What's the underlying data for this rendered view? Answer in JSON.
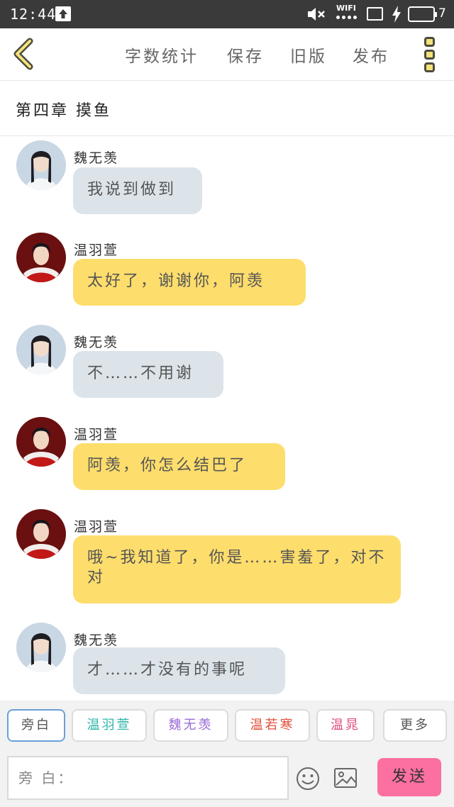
{
  "status_bar": {
    "time": "12:44",
    "network_label": "WIFI",
    "battery_level": "7",
    "battery_fill_fraction": 0.85
  },
  "toolbar": {
    "back_icon": "chevron-left-icon",
    "actions": [
      "字数统计",
      "保存",
      "旧版",
      "发布"
    ],
    "more_icon": "vertical-dots-icon"
  },
  "chapter": {
    "title": "第四章 摸鱼"
  },
  "messages": [
    {
      "sender": "魏无羡",
      "text": "我说到做到",
      "style": "grey"
    },
    {
      "sender": "温羽萱",
      "text": "太好了，谢谢你，阿羡",
      "style": "yellow"
    },
    {
      "sender": "魏无羡",
      "text": "不……不用谢",
      "style": "grey"
    },
    {
      "sender": "温羽萱",
      "text": "阿羡，你怎么结巴了",
      "style": "yellow"
    },
    {
      "sender": "温羽萱",
      "text": "哦~我知道了，你是……害羞了，对不对",
      "style": "yellow"
    },
    {
      "sender": "魏无羡",
      "text": "才……才没有的事呢",
      "style": "grey"
    }
  ],
  "roles": [
    {
      "label": "旁白",
      "color": "#555555"
    },
    {
      "label": "温羽萱",
      "color": "#2ab5a8"
    },
    {
      "label": "魏无羡",
      "color": "#9a6bd6"
    },
    {
      "label": "温若寒",
      "color": "#e2503a"
    },
    {
      "label": "温晁",
      "color": "#e0507f"
    },
    {
      "label": "更多",
      "color": "#555555"
    }
  ],
  "composer": {
    "placeholder": "旁 白：",
    "emoji_icon": "smiley-icon",
    "image_icon": "image-icon",
    "send_label": "发送"
  },
  "colors": {
    "accent_yellow": "#fddd6c",
    "bubble_grey": "#dce4ea",
    "send_pink": "#fb6fa1"
  }
}
